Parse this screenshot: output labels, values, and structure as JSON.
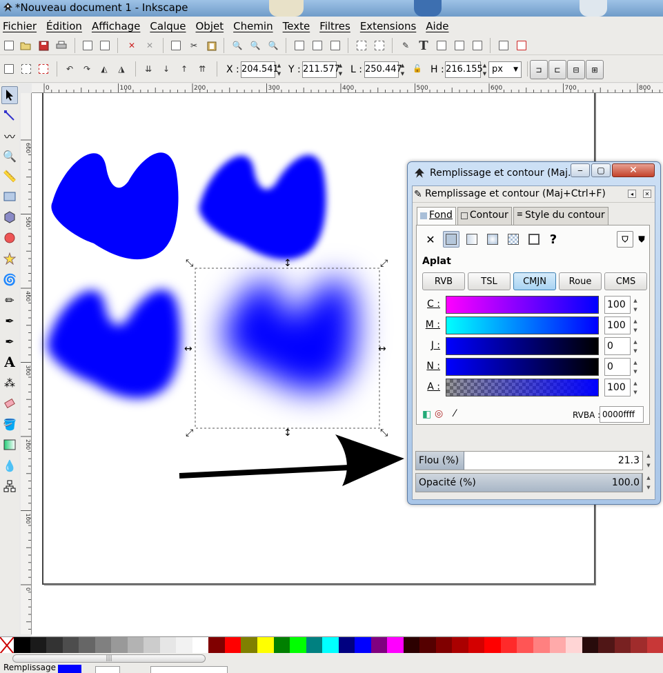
{
  "window": {
    "title": "*Nouveau document 1 - Inkscape"
  },
  "menubar": {
    "items": [
      "Fichier",
      "Édition",
      "Affichage",
      "Calque",
      "Objet",
      "Chemin",
      "Texte",
      "Filtres",
      "Extensions",
      "Aide"
    ]
  },
  "selection_toolbar": {
    "x_label": "X :",
    "x_value": "204.541",
    "y_label": "Y :",
    "y_value": "211.577",
    "w_label": "L :",
    "w_value": "250.447",
    "h_label": "H :",
    "h_value": "216.155",
    "unit": "px"
  },
  "rulers": {
    "horizontal": [
      "0",
      "100",
      "200",
      "300",
      "400",
      "500",
      "600",
      "700",
      "800"
    ],
    "vertical": [
      "600",
      "500",
      "400",
      "300",
      "200",
      "100",
      "0"
    ]
  },
  "dialog": {
    "window_title": "Remplissage et contour (Maj...",
    "panel_title": "Remplissage et contour (Maj+Ctrl+F)",
    "tabs": [
      "Fond",
      "Contour",
      "Style du contour"
    ],
    "unset_icon": "question-mark",
    "unset_symbol": "?",
    "fill_type_title": "Aplat",
    "color_modes": [
      "RVB",
      "TSL",
      "CMJN",
      "Roue",
      "CMS"
    ],
    "active_color_mode": "CMJN",
    "channels": [
      {
        "label": "C :",
        "value": "100"
      },
      {
        "label": "M :",
        "value": "100"
      },
      {
        "label": "J :",
        "value": "0"
      },
      {
        "label": "N :",
        "value": "0"
      },
      {
        "label": "A :",
        "value": "100"
      }
    ],
    "rvba_label": "RVBA :",
    "rvba_value": "0000ffff",
    "blur_label": "Flou (%)",
    "blur_value": "21.3",
    "blur_fraction": 0.213,
    "opacity_label": "Opacité (%)",
    "opacity_value": "100.0",
    "opacity_fraction": 1.0
  },
  "statusbar": {
    "fill_label": "Remplissage :",
    "fill_color": "#0000ff"
  },
  "colors": {
    "shape_blue": "#0000ff",
    "selection_dash": "#555555"
  },
  "palette": [
    "#000000",
    "#1a1a1a",
    "#333333",
    "#4d4d4d",
    "#666666",
    "#808080",
    "#999999",
    "#b3b3b3",
    "#cccccc",
    "#e6e6e6",
    "#f2f2f2",
    "#ffffff",
    "#800000",
    "#ff0000",
    "#808000",
    "#ffff00",
    "#008000",
    "#00ff00",
    "#008080",
    "#00ffff",
    "#000080",
    "#0000ff",
    "#800080",
    "#ff00ff",
    "#2b0000",
    "#550000",
    "#800000",
    "#aa0000",
    "#d40000",
    "#ff0000",
    "#ff2a2a",
    "#ff5555",
    "#ff8080",
    "#ffaaaa",
    "#ffd5d5",
    "#280b0b",
    "#501616",
    "#782121",
    "#a02c2c",
    "#c83737"
  ]
}
